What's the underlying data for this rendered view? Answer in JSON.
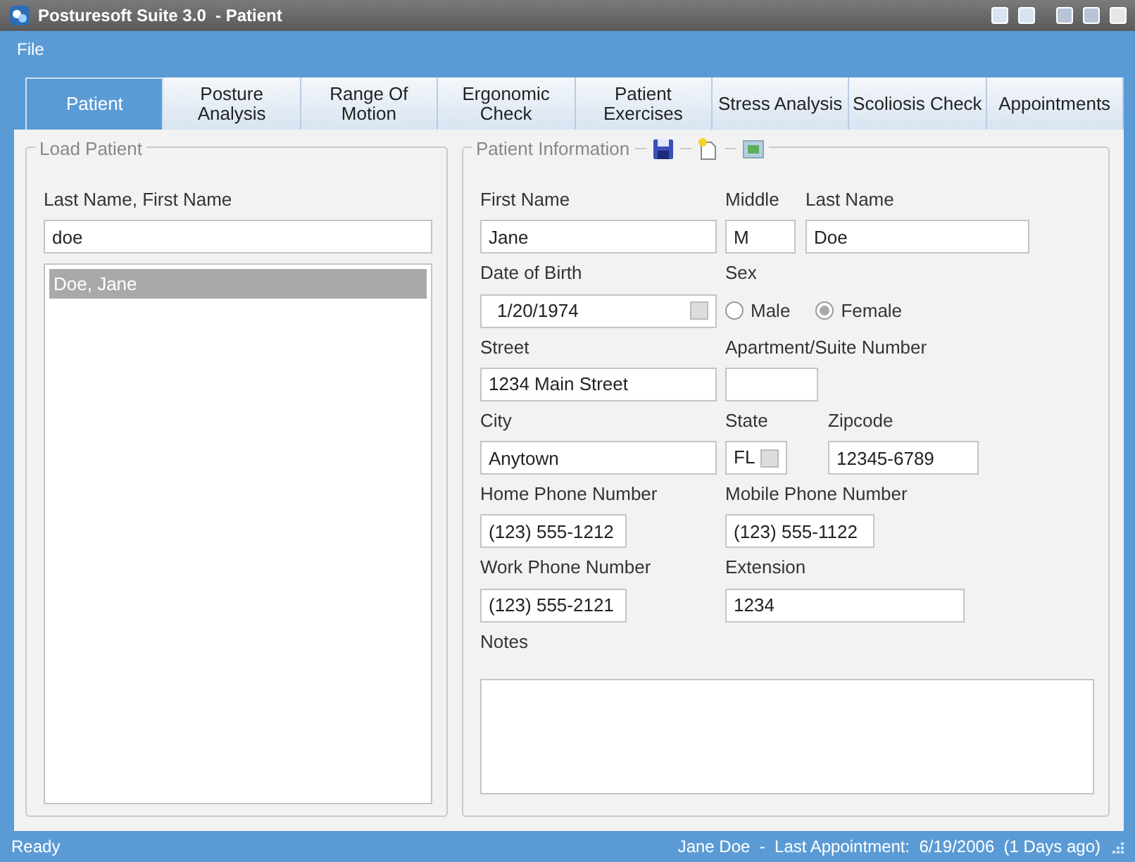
{
  "window": {
    "title": "Posturesoft Suite 3.0  - Patient"
  },
  "menu": [
    "File"
  ],
  "tabs": [
    {
      "label": "Patient",
      "selected": true
    },
    {
      "label": "Posture Analysis",
      "selected": false
    },
    {
      "label": "Range Of Motion",
      "selected": false
    },
    {
      "label": "Ergonomic Check",
      "selected": false
    },
    {
      "label": "Patient Exercises",
      "selected": false
    },
    {
      "label": "Stress Analysis",
      "selected": false
    },
    {
      "label": "Scoliosis Check",
      "selected": false
    },
    {
      "label": "Appointments",
      "selected": false
    }
  ],
  "load_patient": {
    "title": "Load Patient",
    "search_label": "Last Name, First Name",
    "search_value": "doe",
    "results": [
      {
        "label": "Doe, Jane",
        "selected": true
      }
    ]
  },
  "patient_information": {
    "title": "Patient Information",
    "rows": [
      [
        {
          "label": "First Name",
          "kind": "text",
          "value": "Jane"
        },
        {
          "label": "Middle",
          "kind": "text",
          "value": "M"
        },
        {
          "label": "Last Name",
          "kind": "text",
          "value": "Doe"
        }
      ],
      [
        {
          "label": "Date of Birth",
          "kind": "date",
          "value": "1/20/1974"
        },
        {
          "label": "Sex",
          "kind": "radio",
          "options": [
            {
              "label": "Male",
              "selected": false
            },
            {
              "label": "Female",
              "selected": true
            }
          ]
        }
      ],
      [
        {
          "label": "Street",
          "kind": "text",
          "value": "1234 Main Street"
        },
        {
          "label": "Apartment/Suite Number",
          "kind": "text"
        }
      ],
      [
        {
          "label": "City",
          "kind": "text",
          "value": "Anytown"
        },
        {
          "label": "State",
          "kind": "select",
          "value": "FL"
        },
        {
          "label": "Zipcode",
          "kind": "text",
          "value": "12345-6789"
        }
      ],
      [
        {
          "label": "Home Phone Number",
          "kind": "text",
          "value": "(123) 555-1212"
        },
        {
          "label": "Mobile Phone Number",
          "kind": "text",
          "value": "(123) 555-1122"
        }
      ],
      [
        {
          "label": "Work Phone Number",
          "kind": "text",
          "value": "(123) 555-2121"
        },
        {
          "label": "Extension",
          "kind": "text",
          "value": "1234"
        }
      ],
      [
        {
          "label": "Notes",
          "kind": "textarea"
        }
      ]
    ]
  },
  "status_bar": {
    "left": "Ready",
    "right": "Jane Doe  -  Last Appointment:  6/19/2006  (1 Days ago)"
  }
}
